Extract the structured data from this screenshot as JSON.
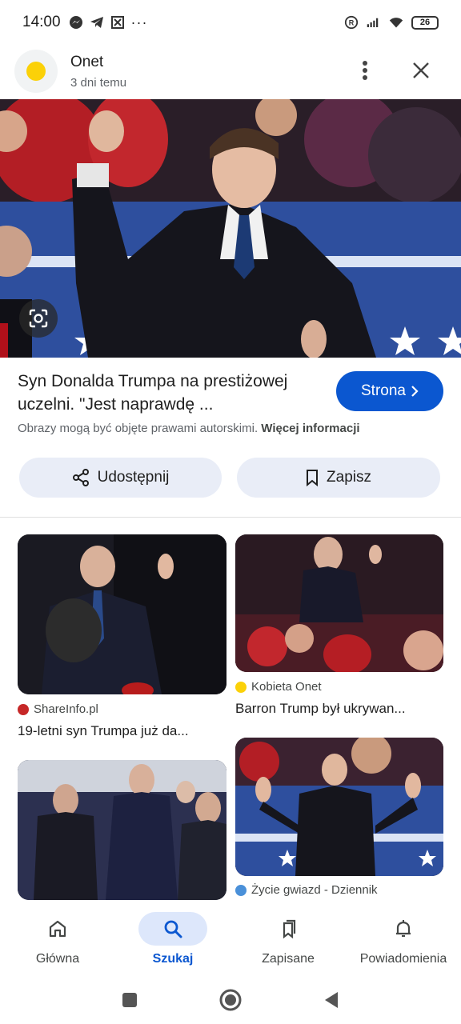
{
  "status_bar": {
    "time": "14:00",
    "battery": "26",
    "more": "···"
  },
  "header": {
    "source_name": "Onet",
    "source_time": "3 dni temu"
  },
  "result": {
    "title": "Syn Donalda Trumpa na prestiżowej uczelni. \"Jest naprawdę ...",
    "visit_label": "Strona",
    "copyright_text": "Obrazy mogą być objęte prawami autorskimi.",
    "copyright_link": "Więcej informacji",
    "share_label": "Udostępnij",
    "save_label": "Zapisz"
  },
  "related": [
    {
      "source": "ShareInfo.pl",
      "source_color": "#c62828",
      "title": "19-letni syn Trumpa już da..."
    },
    {
      "source": "Kobieta Onet",
      "source_color": "#fbd108",
      "title": "Barron Trump był ukrywan..."
    },
    {
      "source": "",
      "source_color": "",
      "title": ""
    },
    {
      "source": "Życie gwiazd - Dziennik",
      "source_color": "#4a90d9",
      "title": ""
    }
  ],
  "bottom_nav": [
    {
      "label": "Główna",
      "icon": "home-icon"
    },
    {
      "label": "Szukaj",
      "icon": "search-icon",
      "active": true
    },
    {
      "label": "Zapisane",
      "icon": "saved-icon"
    },
    {
      "label": "Powiadomienia",
      "icon": "bell-icon"
    }
  ],
  "colors": {
    "accent": "#0b57d0",
    "pill_bg": "#e9edf7",
    "active_nav_bg": "#dde7fb"
  }
}
